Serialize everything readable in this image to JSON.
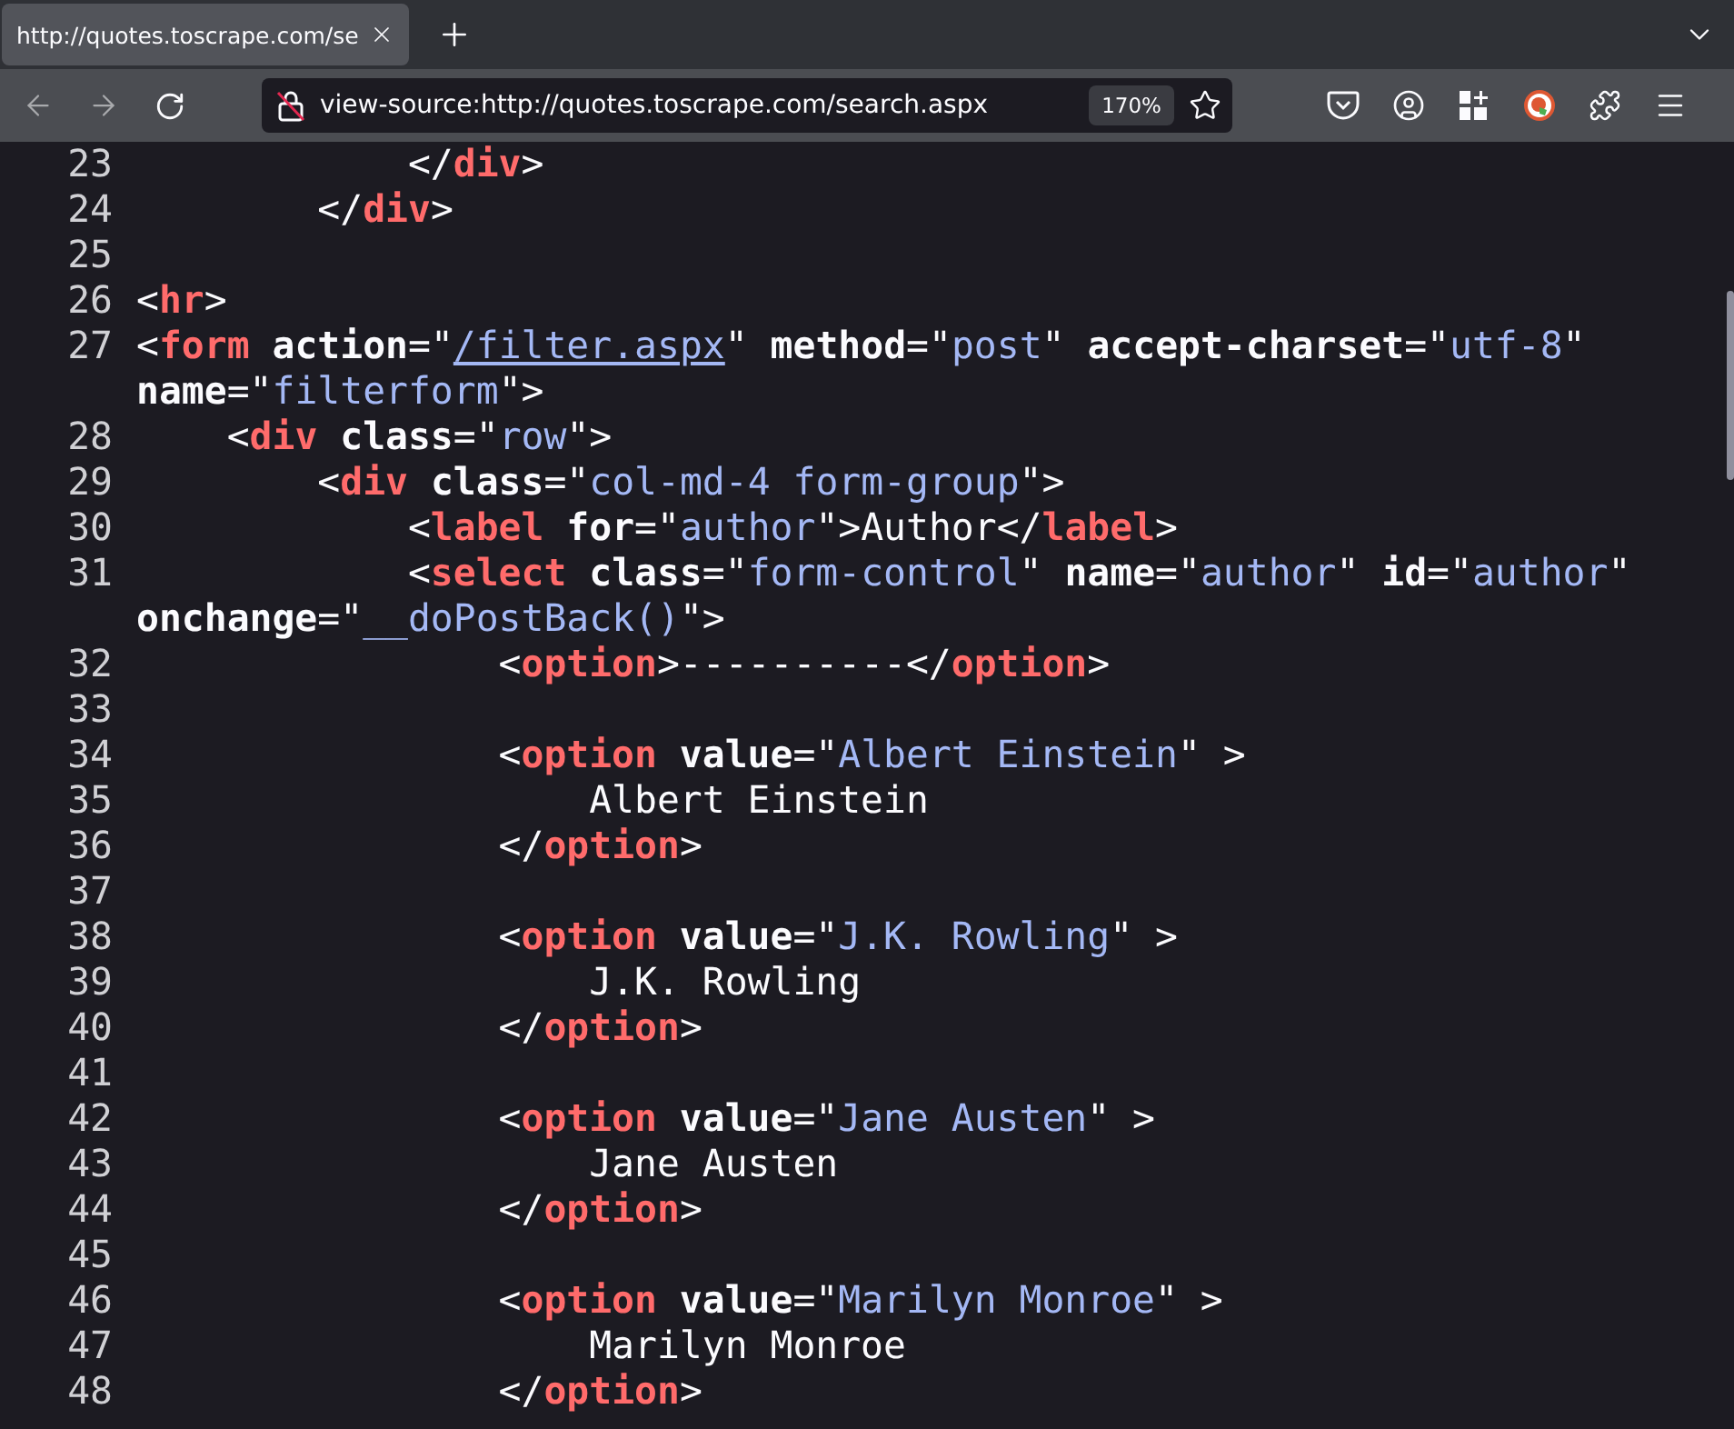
{
  "browser": {
    "tab": {
      "title": "http://quotes.toscrape.com/se",
      "selected": true
    },
    "url": "view-source:http://quotes.toscrape.com/search.aspx",
    "zoom": "170%"
  },
  "source": {
    "lines": [
      {
        "number": "23",
        "rows": [
          {
            "parts": [
              {
                "kind": "punct",
                "text": "            </"
              },
              {
                "kind": "tag",
                "text": "div"
              },
              {
                "kind": "punct",
                "text": ">"
              }
            ]
          }
        ]
      },
      {
        "number": "24",
        "rows": [
          {
            "parts": [
              {
                "kind": "punct",
                "text": "        </"
              },
              {
                "kind": "tag",
                "text": "div"
              },
              {
                "kind": "punct",
                "text": ">"
              }
            ]
          }
        ]
      },
      {
        "number": "25"
      },
      {
        "number": "26",
        "rows": [
          {
            "parts": [
              {
                "kind": "punct",
                "text": "<"
              },
              {
                "kind": "tag",
                "text": "hr"
              },
              {
                "kind": "punct",
                "text": ">"
              }
            ]
          }
        ]
      },
      {
        "number": "27",
        "rows": [
          {
            "parts": [
              {
                "kind": "punct",
                "text": "<"
              },
              {
                "kind": "tag",
                "text": "form"
              },
              {
                "kind": "attr",
                "text": " action"
              },
              {
                "kind": "punct",
                "text": "=\""
              },
              {
                "kind": "link",
                "text": "/filter.aspx"
              },
              {
                "kind": "punct",
                "text": "\" "
              },
              {
                "kind": "attr",
                "text": "method"
              },
              {
                "kind": "punct",
                "text": "=\""
              },
              {
                "kind": "value",
                "text": "post"
              },
              {
                "kind": "punct",
                "text": "\" "
              },
              {
                "kind": "attr",
                "text": "accept-charset"
              },
              {
                "kind": "punct",
                "text": "=\""
              },
              {
                "kind": "value",
                "text": "utf-8"
              },
              {
                "kind": "punct",
                "text": "\""
              }
            ]
          },
          {
            "parts": [
              {
                "kind": "attr",
                "text": "name"
              },
              {
                "kind": "punct",
                "text": "=\""
              },
              {
                "kind": "value",
                "text": "filterform"
              },
              {
                "kind": "punct",
                "text": "\">"
              }
            ]
          }
        ]
      },
      {
        "number": "28",
        "rows": [
          {
            "parts": [
              {
                "kind": "punct",
                "text": "    <"
              },
              {
                "kind": "tag",
                "text": "div"
              },
              {
                "kind": "attr",
                "text": " class"
              },
              {
                "kind": "punct",
                "text": "=\""
              },
              {
                "kind": "value",
                "text": "row"
              },
              {
                "kind": "punct",
                "text": "\">"
              }
            ]
          }
        ]
      },
      {
        "number": "29",
        "rows": [
          {
            "parts": [
              {
                "kind": "punct",
                "text": "        <"
              },
              {
                "kind": "tag",
                "text": "div"
              },
              {
                "kind": "attr",
                "text": " class"
              },
              {
                "kind": "punct",
                "text": "=\""
              },
              {
                "kind": "value",
                "text": "col-md-4 form-group"
              },
              {
                "kind": "punct",
                "text": "\">"
              }
            ]
          }
        ]
      },
      {
        "number": "30",
        "rows": [
          {
            "parts": [
              {
                "kind": "punct",
                "text": "            <"
              },
              {
                "kind": "tag",
                "text": "label"
              },
              {
                "kind": "attr",
                "text": " for"
              },
              {
                "kind": "punct",
                "text": "=\""
              },
              {
                "kind": "value",
                "text": "author"
              },
              {
                "kind": "punct",
                "text": "\">Author</"
              },
              {
                "kind": "tag",
                "text": "label"
              },
              {
                "kind": "punct",
                "text": ">"
              }
            ]
          }
        ]
      },
      {
        "number": "31",
        "rows": [
          {
            "parts": [
              {
                "kind": "punct",
                "text": "            <"
              },
              {
                "kind": "tag",
                "text": "select"
              },
              {
                "kind": "attr",
                "text": " class"
              },
              {
                "kind": "punct",
                "text": "=\""
              },
              {
                "kind": "value",
                "text": "form-control"
              },
              {
                "kind": "punct",
                "text": "\" "
              },
              {
                "kind": "attr",
                "text": "name"
              },
              {
                "kind": "punct",
                "text": "=\""
              },
              {
                "kind": "value",
                "text": "author"
              },
              {
                "kind": "punct",
                "text": "\" "
              },
              {
                "kind": "attr",
                "text": "id"
              },
              {
                "kind": "punct",
                "text": "=\""
              },
              {
                "kind": "value",
                "text": "author"
              },
              {
                "kind": "punct",
                "text": "\""
              }
            ]
          },
          {
            "parts": [
              {
                "kind": "attr",
                "text": "onchange"
              },
              {
                "kind": "punct",
                "text": "=\""
              },
              {
                "kind": "value",
                "text": "__doPostBack()"
              },
              {
                "kind": "punct",
                "text": "\">"
              }
            ]
          }
        ]
      },
      {
        "number": "32",
        "rows": [
          {
            "parts": [
              {
                "kind": "punct",
                "text": "                <"
              },
              {
                "kind": "tag",
                "text": "option"
              },
              {
                "kind": "punct",
                "text": ">----------</"
              },
              {
                "kind": "tag",
                "text": "option"
              },
              {
                "kind": "punct",
                "text": ">"
              }
            ]
          }
        ]
      },
      {
        "number": "33"
      },
      {
        "number": "34",
        "rows": [
          {
            "parts": [
              {
                "kind": "punct",
                "text": "                <"
              },
              {
                "kind": "tag",
                "text": "option"
              },
              {
                "kind": "attr",
                "text": " value"
              },
              {
                "kind": "punct",
                "text": "=\""
              },
              {
                "kind": "value",
                "text": "Albert Einstein"
              },
              {
                "kind": "punct",
                "text": "\" >"
              }
            ]
          }
        ]
      },
      {
        "number": "35",
        "rows": [
          {
            "parts": [
              {
                "kind": "punct",
                "text": "                    Albert Einstein"
              }
            ]
          }
        ]
      },
      {
        "number": "36",
        "rows": [
          {
            "parts": [
              {
                "kind": "punct",
                "text": "                </"
              },
              {
                "kind": "tag",
                "text": "option"
              },
              {
                "kind": "punct",
                "text": ">"
              }
            ]
          }
        ]
      },
      {
        "number": "37"
      },
      {
        "number": "38",
        "rows": [
          {
            "parts": [
              {
                "kind": "punct",
                "text": "                <"
              },
              {
                "kind": "tag",
                "text": "option"
              },
              {
                "kind": "attr",
                "text": " value"
              },
              {
                "kind": "punct",
                "text": "=\""
              },
              {
                "kind": "value",
                "text": "J.K. Rowling"
              },
              {
                "kind": "punct",
                "text": "\" >"
              }
            ]
          }
        ]
      },
      {
        "number": "39",
        "rows": [
          {
            "parts": [
              {
                "kind": "punct",
                "text": "                    J.K. Rowling"
              }
            ]
          }
        ]
      },
      {
        "number": "40",
        "rows": [
          {
            "parts": [
              {
                "kind": "punct",
                "text": "                </"
              },
              {
                "kind": "tag",
                "text": "option"
              },
              {
                "kind": "punct",
                "text": ">"
              }
            ]
          }
        ]
      },
      {
        "number": "41"
      },
      {
        "number": "42",
        "rows": [
          {
            "parts": [
              {
                "kind": "punct",
                "text": "                <"
              },
              {
                "kind": "tag",
                "text": "option"
              },
              {
                "kind": "attr",
                "text": " value"
              },
              {
                "kind": "punct",
                "text": "=\""
              },
              {
                "kind": "value",
                "text": "Jane Austen"
              },
              {
                "kind": "punct",
                "text": "\" >"
              }
            ]
          }
        ]
      },
      {
        "number": "43",
        "rows": [
          {
            "parts": [
              {
                "kind": "punct",
                "text": "                    Jane Austen"
              }
            ]
          }
        ]
      },
      {
        "number": "44",
        "rows": [
          {
            "parts": [
              {
                "kind": "punct",
                "text": "                </"
              },
              {
                "kind": "tag",
                "text": "option"
              },
              {
                "kind": "punct",
                "text": ">"
              }
            ]
          }
        ]
      },
      {
        "number": "45"
      },
      {
        "number": "46",
        "rows": [
          {
            "parts": [
              {
                "kind": "punct",
                "text": "                <"
              },
              {
                "kind": "tag",
                "text": "option"
              },
              {
                "kind": "attr",
                "text": " value"
              },
              {
                "kind": "punct",
                "text": "=\""
              },
              {
                "kind": "value",
                "text": "Marilyn Monroe"
              },
              {
                "kind": "punct",
                "text": "\" >"
              }
            ]
          }
        ]
      },
      {
        "number": "47",
        "rows": [
          {
            "parts": [
              {
                "kind": "punct",
                "text": "                    Marilyn Monroe"
              }
            ]
          }
        ]
      },
      {
        "number": "48",
        "rows": [
          {
            "parts": [
              {
                "kind": "punct",
                "text": "                </"
              },
              {
                "kind": "tag",
                "text": "option"
              },
              {
                "kind": "punct",
                "text": ">"
              }
            ]
          }
        ]
      }
    ]
  }
}
